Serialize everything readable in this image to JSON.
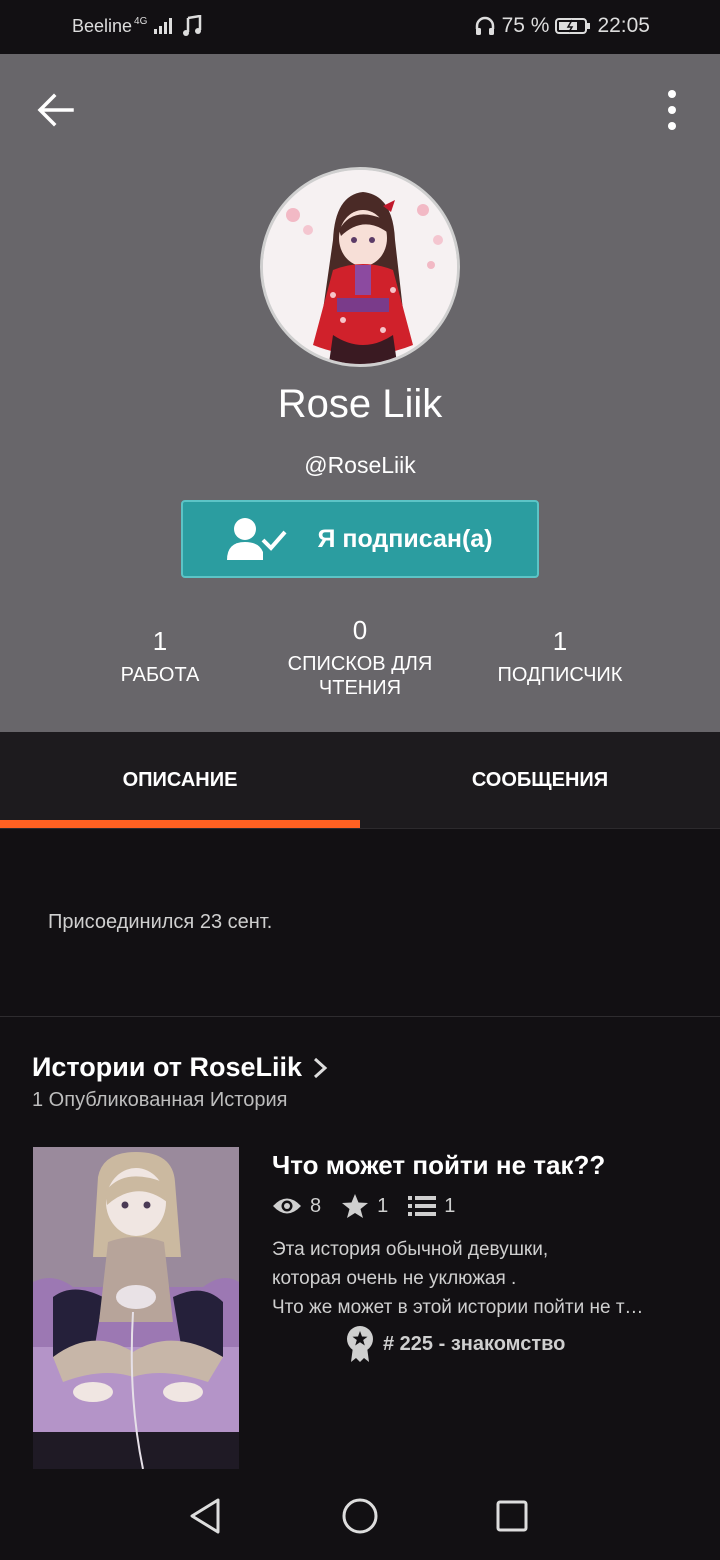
{
  "status_bar": {
    "carrier": "Beeline",
    "network": "4G",
    "battery": "75 %",
    "time": "22:05",
    "icons": [
      "signal-icon",
      "music-note-icon",
      "headphones-icon",
      "battery-icon"
    ]
  },
  "profile": {
    "name": "Rose Liik",
    "handle": "@RoseLiik",
    "follow_label": "Я подписан(а)",
    "stats": [
      {
        "num": "1",
        "label": "РАБОТА"
      },
      {
        "num": "0",
        "label": "СПИСКОВ ДЛЯ ЧТЕНИЯ"
      },
      {
        "num": "1",
        "label": "ПОДПИСЧИК"
      }
    ]
  },
  "tabs": [
    {
      "label": "ОПИСАНИЕ",
      "active": true
    },
    {
      "label": "СООБЩЕНИЯ",
      "active": false
    }
  ],
  "about": {
    "joined": "Присоединился 23 сент."
  },
  "stories": {
    "title": "Истории от RoseLiik",
    "subtitle": "1 Опубликованная История",
    "items": [
      {
        "title": "Что может пойти не так??",
        "views": "8",
        "votes": "1",
        "parts": "1",
        "description_lines": [
          "Эта история обычной девушки,",
          "которая очень не уклюжая .",
          "Что же может в этой истории пойти не так?"
        ],
        "rank": "# 225 - знакомство"
      }
    ]
  },
  "colors": {
    "header_bg": "#68666a",
    "follow_btn": "#2b9da0",
    "tab_accent": "#ff6122",
    "page_bg": "#121013"
  }
}
